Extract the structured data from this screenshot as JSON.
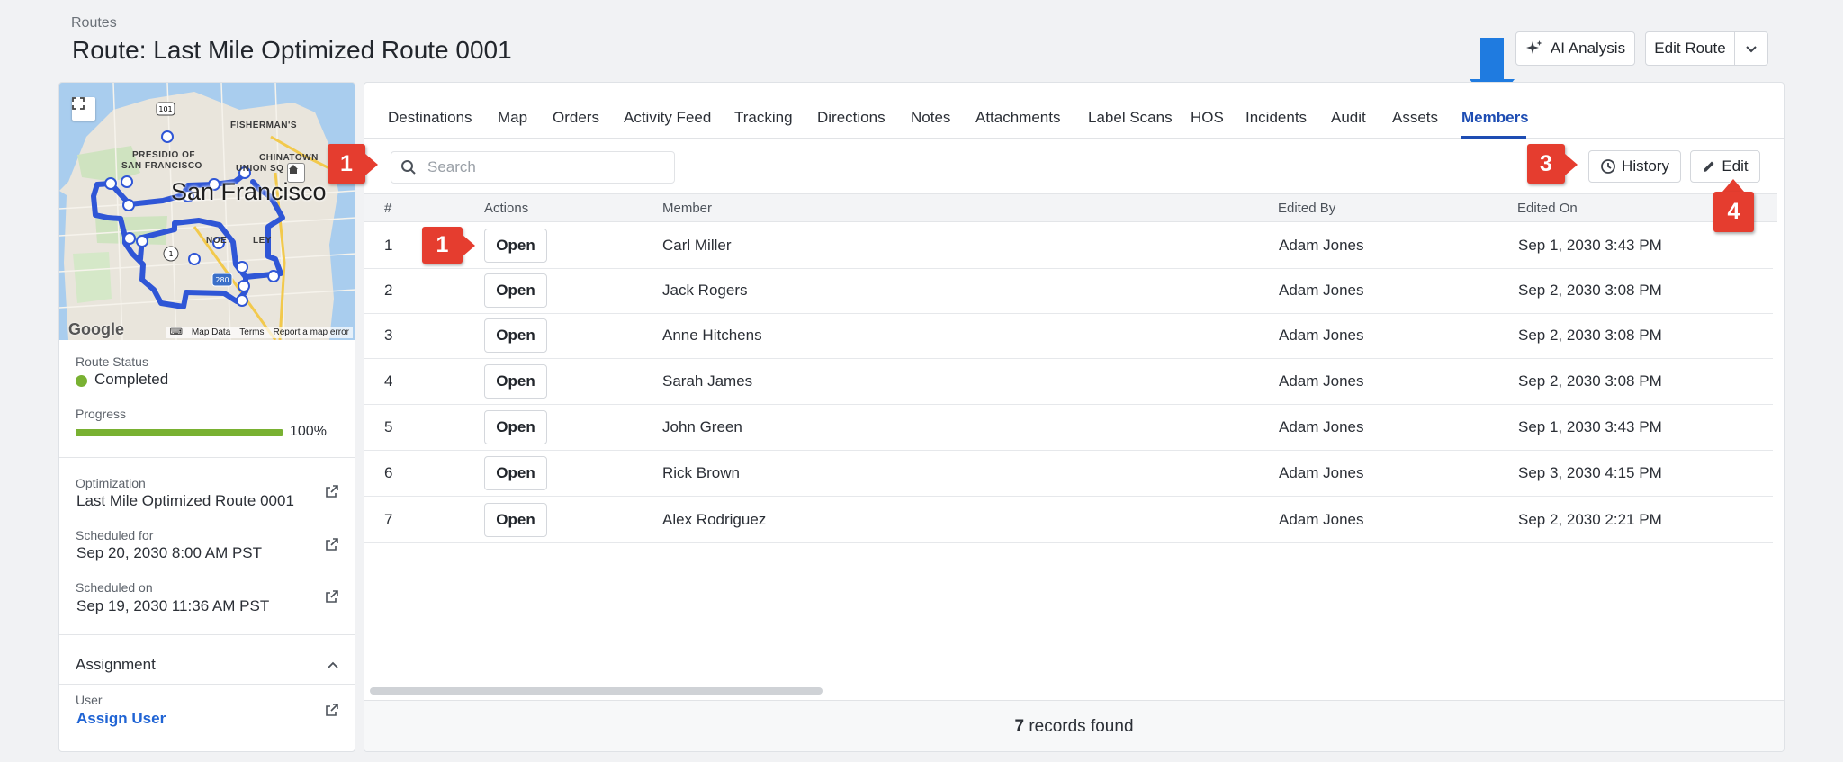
{
  "header": {
    "breadcrumb": "Routes",
    "title": "Route: Last Mile Optimized Route 0001",
    "ai_button": "AI Analysis",
    "edit_route_button": "Edit Route"
  },
  "map": {
    "city": "San Francisco",
    "labels": [
      "FISHERMAN'S",
      "PRESIDIO OF",
      "SAN FRANCISCO",
      "CHINATOWN",
      "UNION SQ",
      "NOE",
      "LEY"
    ],
    "road_shields": [
      "101",
      "1",
      "280"
    ],
    "google": "Google",
    "links": [
      "Map Data",
      "Terms",
      "Report a map error"
    ]
  },
  "left": {
    "status_label": "Route Status",
    "status_value": "Completed",
    "progress_label": "Progress",
    "progress_value": "100%",
    "progress_fraction": 1.0,
    "optimization_label": "Optimization",
    "optimization_value": "Last Mile Optimized Route 0001",
    "scheduled_for_label": "Scheduled for",
    "scheduled_for_value": "Sep 20, 2030 8:00 AM PST",
    "scheduled_on_label": "Scheduled on",
    "scheduled_on_value": "Sep 19, 2030 11:36 AM PST",
    "assignment_label": "Assignment",
    "user_label": "User",
    "user_value": "Assign User"
  },
  "tabs": [
    "Destinations",
    "Map",
    "Orders",
    "Activity Feed",
    "Tracking",
    "Directions",
    "Notes",
    "Attachments",
    "Label Scans",
    "HOS",
    "Incidents",
    "Audit",
    "Assets",
    "Members"
  ],
  "active_tab": "Members",
  "search": {
    "placeholder": "Search"
  },
  "toolbar": {
    "history": "History",
    "edit": "Edit"
  },
  "table": {
    "columns": [
      "#",
      "Actions",
      "Member",
      "Edited By",
      "Edited On"
    ],
    "action_label": "Open",
    "rows": [
      {
        "n": "1",
        "member": "Carl Miller",
        "edited_by": "Adam Jones",
        "edited_on": "Sep 1, 2030 3:43 PM"
      },
      {
        "n": "2",
        "member": "Jack Rogers",
        "edited_by": "Adam Jones",
        "edited_on": "Sep 2, 2030 3:08 PM"
      },
      {
        "n": "3",
        "member": "Anne Hitchens",
        "edited_by": "Adam Jones",
        "edited_on": "Sep 2, 2030 3:08 PM"
      },
      {
        "n": "4",
        "member": "Sarah James",
        "edited_by": "Adam Jones",
        "edited_on": "Sep 2, 2030 3:08 PM"
      },
      {
        "n": "5",
        "member": "John Green",
        "edited_by": "Adam Jones",
        "edited_on": "Sep 1, 2030 3:43 PM"
      },
      {
        "n": "6",
        "member": "Rick Brown",
        "edited_by": "Adam Jones",
        "edited_on": "Sep 3, 2030 4:15 PM"
      },
      {
        "n": "7",
        "member": "Alex Rodriguez",
        "edited_by": "Adam Jones",
        "edited_on": "Sep 2, 2030 2:21 PM"
      }
    ]
  },
  "footer": {
    "count": "7",
    "suffix": " records found"
  },
  "callouts": {
    "search": "1",
    "open": "1",
    "history": "3",
    "edit": "4"
  },
  "colors": {
    "accent": "#1e4db3",
    "status_green": "#79b132",
    "callout_red": "#e53d2f",
    "pointer_blue": "#1f7be0",
    "route_blue": "#2f56d6"
  },
  "icons": {
    "ai": "sparkle-icon",
    "dropdown": "chevron-down-icon",
    "search": "search-icon",
    "history": "clock-icon",
    "edit": "pencil-icon",
    "external": "external-link-icon",
    "collapse": "chevron-up-icon",
    "expand_map": "fullscreen-icon"
  }
}
